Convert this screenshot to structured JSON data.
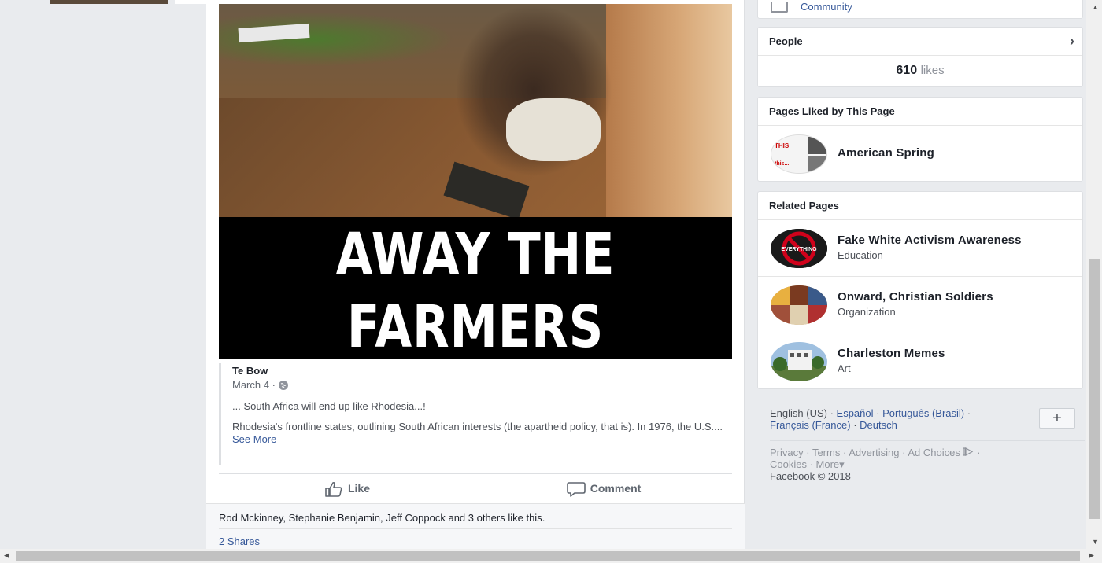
{
  "post": {
    "image_caption_line1": "AWAY THE",
    "image_caption_line2": "FARMERS",
    "shared": {
      "author": "Te Bow",
      "date": "March 4 ·",
      "text1": "... South Africa will end up like Rhodesia...!",
      "text2": "Rhodesia's frontline states, outlining South African interests (the apartheid policy, that is). In 1976, the U.S....",
      "see_more": "See More"
    },
    "actions": {
      "like": "Like",
      "comment": "Comment"
    },
    "likes_text": "Rod Mckinney, Stephanie Benjamin, Jeff Coppock and 3 others like this.",
    "shares": "2 Shares"
  },
  "sidebar": {
    "community_label": "Community",
    "people": {
      "title": "People",
      "likes_number": "610",
      "likes_word": "likes"
    },
    "pages_liked": {
      "title": "Pages Liked by This Page",
      "items": [
        {
          "name": "American Spring",
          "avatar_text1": "THIS",
          "avatar_text2": "this..."
        }
      ]
    },
    "related_pages": {
      "title": "Related Pages",
      "items": [
        {
          "name": "Fake White Activism Awareness",
          "category": "Education",
          "avatar_text": "EVERYTHING"
        },
        {
          "name": "Onward, Christian Soldiers",
          "category": "Organization"
        },
        {
          "name": "Charleston Memes",
          "category": "Art"
        }
      ]
    },
    "languages": {
      "current": "English (US)",
      "options": [
        "Español",
        "Português (Brasil)",
        "Français (France)",
        "Deutsch"
      ],
      "add_label": "+"
    },
    "footer": {
      "links1": [
        "Privacy",
        "Terms",
        "Advertising",
        "Ad Choices"
      ],
      "links2": [
        "Cookies",
        "More"
      ],
      "copyright": "Facebook © 2018"
    }
  },
  "colors": {
    "background": "#e9ebee",
    "link": "#365899",
    "text": "#1d2129",
    "muted": "#90949c"
  }
}
